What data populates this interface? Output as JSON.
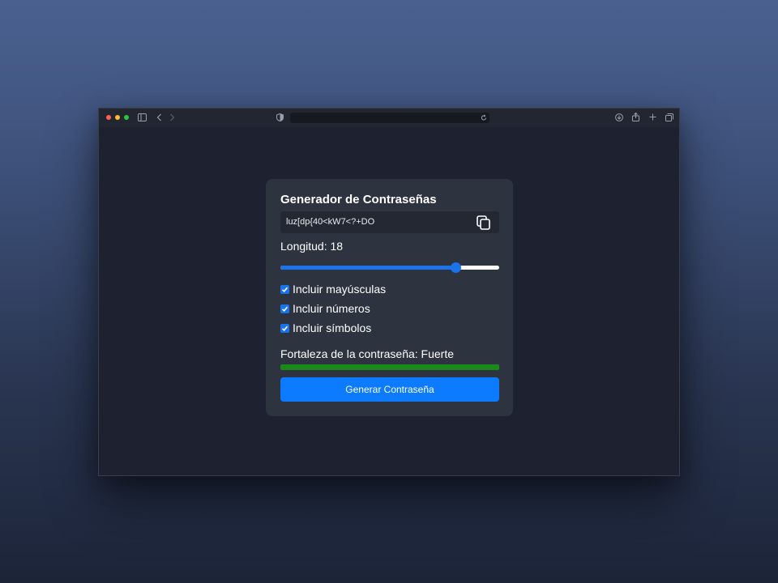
{
  "browser": {
    "url": "",
    "traffic_lights": {
      "close": "#ff5f57",
      "minimize": "#febc2e",
      "zoom": "#28c840"
    },
    "icons": [
      "sidebar-icon",
      "back-icon",
      "forward-icon",
      "shield-icon",
      "reload-icon",
      "download-icon",
      "share-icon",
      "new-tab-icon",
      "tabs-overview-icon"
    ]
  },
  "app": {
    "title": "Generador de Contraseñas",
    "password": "luz[dp{40<kW7<?+DO",
    "copy_icon": "copy-icon",
    "length_label": "Longitud: 18",
    "length": {
      "value": 18,
      "fraction": 0.8
    },
    "options": [
      {
        "label": "Incluir mayúsculas",
        "checked": true
      },
      {
        "label": "Incluir números",
        "checked": true
      },
      {
        "label": "Incluir símbolos",
        "checked": true
      }
    ],
    "strength_label": "Fortaleza de la contraseña: Fuerte",
    "strength": {
      "level": "Fuerte",
      "fraction": 1.0,
      "color": "#1a8a1a"
    },
    "generate_label": "Generar Contraseña",
    "accent_color": "#0d7bff"
  }
}
